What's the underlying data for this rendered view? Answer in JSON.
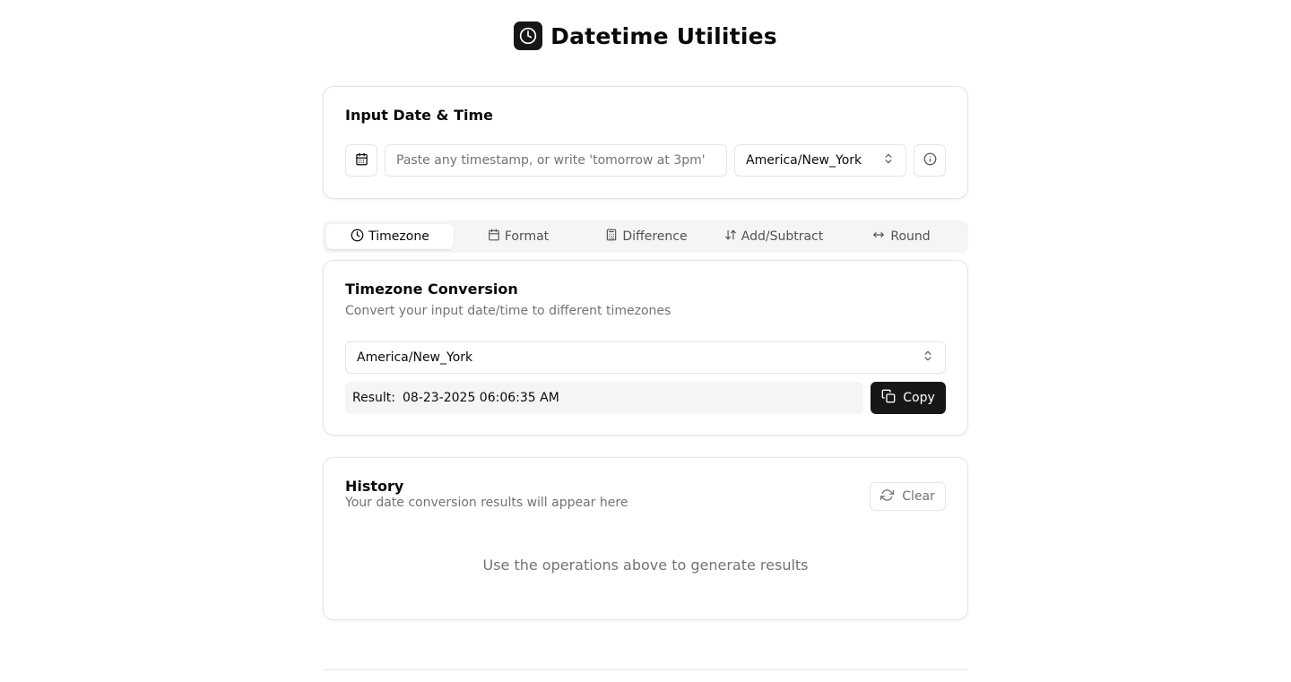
{
  "app": {
    "title": "Datetime Utilities",
    "logo_icon": "clock-icon"
  },
  "input_card": {
    "title": "Input Date & Time",
    "input_placeholder": "Paste any timestamp, or write 'tomorrow at 3pm'",
    "input_value": "",
    "timezone": "America/New_York",
    "calendar_icon": "calendar-icon",
    "info_icon": "info-icon"
  },
  "tabs": [
    {
      "label": "Timezone",
      "icon": "clock-icon",
      "active": true
    },
    {
      "label": "Format",
      "icon": "calendar-icon",
      "active": false
    },
    {
      "label": "Difference",
      "icon": "calculator-icon",
      "active": false
    },
    {
      "label": "Add/Subtract",
      "icon": "arrow-up-down-icon",
      "active": false
    },
    {
      "label": "Round",
      "icon": "arrow-left-right-icon",
      "active": false
    }
  ],
  "timezone_card": {
    "title": "Timezone Conversion",
    "description": "Convert your input date/time to different timezones",
    "target_timezone": "America/New_York",
    "result_label": "Result:",
    "result_value": "08-23-2025 06:06:35 AM",
    "copy_label": "Copy"
  },
  "history": {
    "title": "History",
    "description": "Your date conversion results will appear here",
    "clear_label": "Clear",
    "empty_text": "Use the operations above to generate results"
  },
  "colors": {
    "primary": "#171717",
    "border": "#e5e5e5",
    "muted": "#737373",
    "muted_bg": "#f5f5f5"
  }
}
